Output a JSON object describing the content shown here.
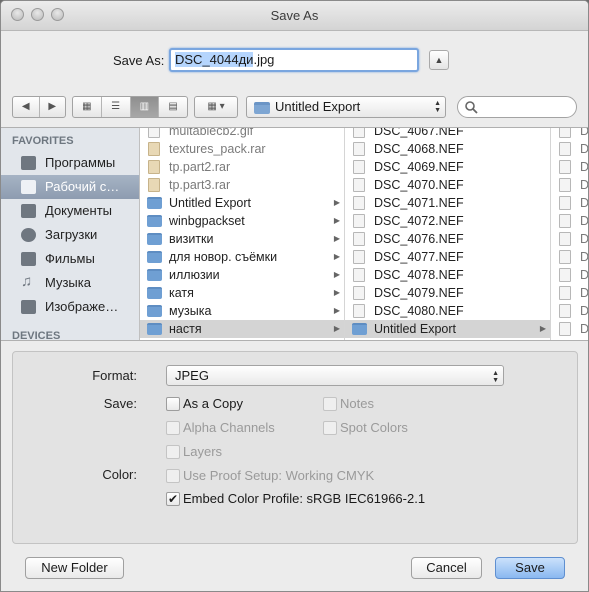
{
  "window": {
    "title": "Save As"
  },
  "save_as": {
    "label": "Save As:",
    "filename_selected": "DSC_4044ди",
    "filename_ext": ".jpg"
  },
  "toolbar": {
    "location": "Untitled Export"
  },
  "sidebar": {
    "favorites_header": "FAVORITES",
    "devices_header": "DEVICES",
    "items": [
      {
        "label": "Программы",
        "icon": "applications-icon"
      },
      {
        "label": "Рабочий с…",
        "icon": "desktop-icon"
      },
      {
        "label": "Документы",
        "icon": "documents-icon"
      },
      {
        "label": "Загрузки",
        "icon": "downloads-icon"
      },
      {
        "label": "Фильмы",
        "icon": "movies-icon"
      },
      {
        "label": "Музыка",
        "icon": "music-icon"
      },
      {
        "label": "Изображе…",
        "icon": "pictures-icon"
      }
    ]
  },
  "column1": [
    {
      "name": "multablecb2.gif",
      "kind": "file",
      "dim": true
    },
    {
      "name": "textures_pack.rar",
      "kind": "rar",
      "dim": true
    },
    {
      "name": "tp.part2.rar",
      "kind": "rar",
      "dim": true
    },
    {
      "name": "tp.part3.rar",
      "kind": "rar",
      "dim": true
    },
    {
      "name": "Untitled Export",
      "kind": "folder",
      "dim": false
    },
    {
      "name": "winbgpackset",
      "kind": "folder",
      "dim": false
    },
    {
      "name": "визитки",
      "kind": "folder",
      "dim": false
    },
    {
      "name": "для новор. съёмки",
      "kind": "folder",
      "dim": false
    },
    {
      "name": "иллюзии",
      "kind": "folder",
      "dim": false
    },
    {
      "name": "катя",
      "kind": "folder",
      "dim": false
    },
    {
      "name": "музыка",
      "kind": "folder",
      "dim": false
    },
    {
      "name": "настя",
      "kind": "folder",
      "dim": false,
      "selected": true
    }
  ],
  "column2": [
    {
      "name": "DSC_4067.NEF"
    },
    {
      "name": "DSC_4068.NEF"
    },
    {
      "name": "DSC_4069.NEF"
    },
    {
      "name": "DSC_4070.NEF"
    },
    {
      "name": "DSC_4071.NEF"
    },
    {
      "name": "DSC_4072.NEF"
    },
    {
      "name": "DSC_4076.NEF"
    },
    {
      "name": "DSC_4077.NEF"
    },
    {
      "name": "DSC_4078.NEF"
    },
    {
      "name": "DSC_4079.NEF"
    },
    {
      "name": "DSC_4080.NEF"
    },
    {
      "name": "Untitled Export",
      "kind": "folder",
      "selected": true
    }
  ],
  "column3": [
    "D",
    "D",
    "D",
    "D",
    "D",
    "D",
    "D",
    "D",
    "D",
    "D",
    "D",
    "D"
  ],
  "options": {
    "format_label": "Format:",
    "format_value": "JPEG",
    "save_label": "Save:",
    "as_a_copy": "As a Copy",
    "notes": "Notes",
    "alpha_channels": "Alpha Channels",
    "spot_colors": "Spot Colors",
    "layers": "Layers",
    "color_label": "Color:",
    "use_proof_setup": "Use Proof Setup:  Working CMYK",
    "embed_color_profile": "Embed Color Profile:  sRGB IEC61966-2.1",
    "embed_checked": true
  },
  "buttons": {
    "new_folder": "New Folder",
    "cancel": "Cancel",
    "save": "Save"
  }
}
